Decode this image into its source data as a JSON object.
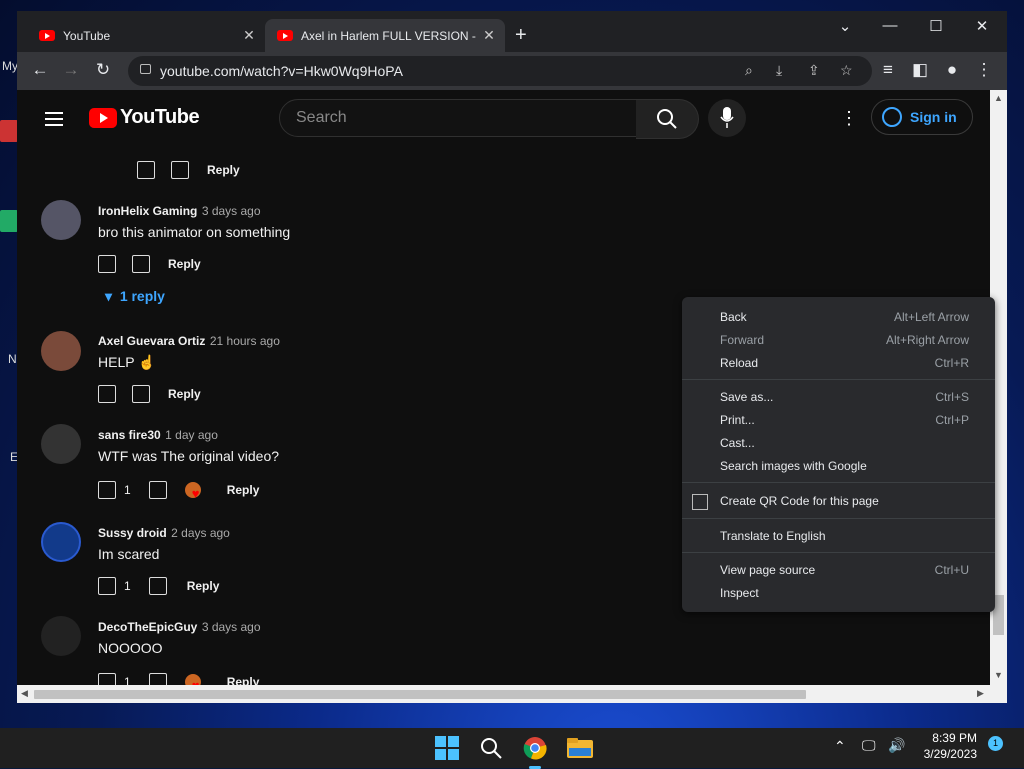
{
  "desktop": {
    "labels": [
      "My",
      "N",
      "E"
    ]
  },
  "browser": {
    "tabs": [
      {
        "title": "YouTube"
      },
      {
        "title": "Axel in Harlem FULL VERSION - YouTube"
      }
    ],
    "new_tab": "+",
    "url": "youtube.com/watch?v=Hkw0Wq9HoPA"
  },
  "youtube": {
    "logo_text": "YouTube",
    "search_placeholder": "Search",
    "sign_in": "Sign in"
  },
  "comments": [
    {
      "type": "actions_only",
      "reply": "Reply"
    },
    {
      "author": "IronHelix Gaming",
      "time": "3 days ago",
      "text": "bro this animator on something",
      "likes": "",
      "hearted": false,
      "reply": "Reply",
      "replies_label": "1 reply"
    },
    {
      "author": "Axel Guevara Ortiz",
      "time": "21 hours ago",
      "text": "HELP ☝",
      "likes": "",
      "hearted": false,
      "reply": "Reply"
    },
    {
      "author": "sans fire30",
      "time": "1 day ago",
      "text": "WTF was The original video?",
      "likes": "1",
      "hearted": true,
      "reply": "Reply"
    },
    {
      "author": "Sussy droid",
      "time": "2 days ago",
      "text": "Im scared",
      "likes": "1",
      "hearted": false,
      "reply": "Reply"
    },
    {
      "author": "DecoTheEpicGuy",
      "time": "3 days ago",
      "text": "NOOOOO",
      "likes": "1",
      "hearted": true,
      "reply": "Reply"
    }
  ],
  "context_menu": {
    "items": [
      {
        "label": "Back",
        "shortcut": "Alt+Left Arrow",
        "disabled": false
      },
      {
        "label": "Forward",
        "shortcut": "Alt+Right Arrow",
        "disabled": true
      },
      {
        "label": "Reload",
        "shortcut": "Ctrl+R",
        "disabled": false
      },
      {
        "label": "Save as...",
        "shortcut": "Ctrl+S",
        "disabled": false
      },
      {
        "label": "Print...",
        "shortcut": "Ctrl+P",
        "disabled": false
      },
      {
        "label": "Cast...",
        "shortcut": "",
        "disabled": false
      },
      {
        "label": "Search images with Google",
        "shortcut": "",
        "disabled": false
      },
      {
        "label": "Create QR Code for this page",
        "shortcut": "",
        "disabled": false
      },
      {
        "label": "Translate to English",
        "shortcut": "",
        "disabled": false
      },
      {
        "label": "View page source",
        "shortcut": "Ctrl+U",
        "disabled": false
      },
      {
        "label": "Inspect",
        "shortcut": "",
        "disabled": false
      }
    ]
  },
  "taskbar": {
    "time": "8:39 PM",
    "date": "3/29/2023",
    "notifications": "1"
  },
  "colors": {
    "page_bg": "#0f0f0f",
    "accent_link": "#3ea6ff",
    "yt_red": "#ff0000",
    "menu_bg": "#292a2d"
  }
}
